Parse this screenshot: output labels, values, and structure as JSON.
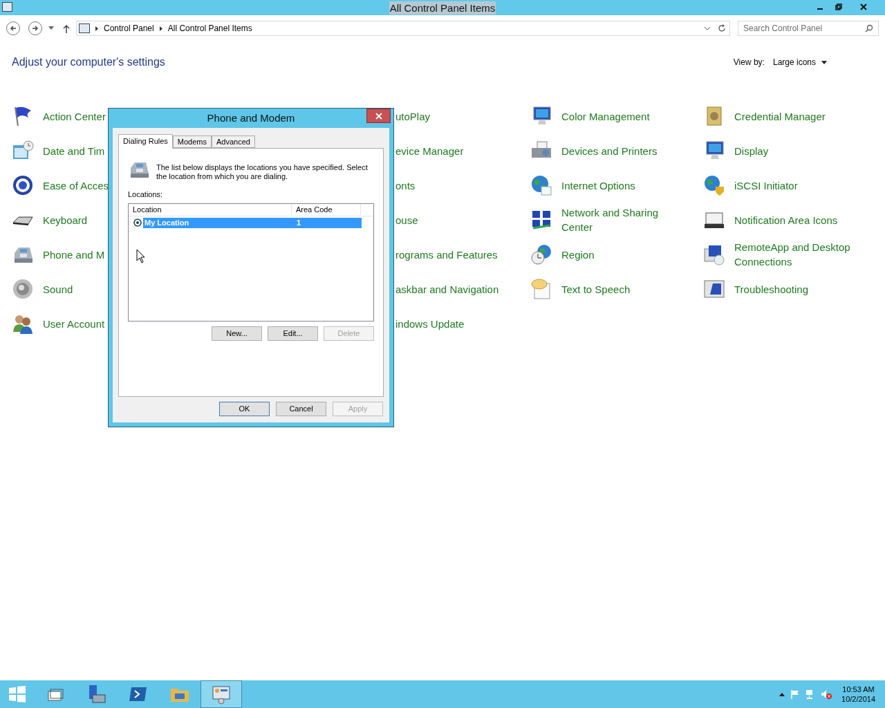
{
  "window": {
    "title": "All Control Panel Items"
  },
  "address_bar": {
    "breadcrumbs": [
      "Control Panel",
      "All Control Panel Items"
    ]
  },
  "search": {
    "placeholder": "Search Control Panel"
  },
  "heading": "Adjust your computer's settings",
  "view_by": {
    "label": "View by:",
    "value": "Large icons"
  },
  "columns": [
    {
      "items": [
        {
          "label": "Action Center"
        },
        {
          "label": "Date and Tim"
        },
        {
          "label": "Ease of Acces"
        },
        {
          "label": "Keyboard"
        },
        {
          "label": "Phone and M"
        },
        {
          "label": "Sound"
        },
        {
          "label": "User Account"
        }
      ]
    },
    {
      "items": [
        {
          "label": "utoPlay"
        },
        {
          "label": "evice Manager"
        },
        {
          "label": "onts"
        },
        {
          "label": "ouse"
        },
        {
          "label": "rograms and Features"
        },
        {
          "label": "askbar and Navigation"
        },
        {
          "label": "indows Update"
        }
      ]
    },
    {
      "items": [
        {
          "label": "Color Management"
        },
        {
          "label": "Devices and Printers"
        },
        {
          "label": "Internet Options"
        },
        {
          "label": "Network and Sharing Center"
        },
        {
          "label": "Region"
        },
        {
          "label": "Text to Speech"
        }
      ]
    },
    {
      "items": [
        {
          "label": "Credential Manager"
        },
        {
          "label": "Display"
        },
        {
          "label": "iSCSI Initiator"
        },
        {
          "label": "Notification Area Icons"
        },
        {
          "label": "RemoteApp and Desktop Connections"
        },
        {
          "label": "Troubleshooting"
        }
      ]
    }
  ],
  "dialog": {
    "title": "Phone and Modem",
    "tabs": [
      {
        "label": "Dialing Rules",
        "selected": true
      },
      {
        "label": "Modems",
        "selected": false
      },
      {
        "label": "Advanced",
        "selected": false
      }
    ],
    "description": "The list below displays the locations you have specified. Select the location from which you are dialing.",
    "locations_label": "Locations:",
    "list": {
      "columns": [
        "Location",
        "Area Code"
      ],
      "rows": [
        {
          "location": "My Location",
          "area_code": "1",
          "selected": true
        }
      ]
    },
    "list_buttons": [
      {
        "label": "New...",
        "disabled": false
      },
      {
        "label": "Edit...",
        "disabled": false
      },
      {
        "label": "Delete",
        "disabled": true
      }
    ],
    "footer_buttons": [
      {
        "label": "OK",
        "disabled": false,
        "default": true
      },
      {
        "label": "Cancel",
        "disabled": false,
        "default": false
      },
      {
        "label": "Apply",
        "disabled": true,
        "default": false
      }
    ]
  },
  "taskbar": {
    "apps": [
      {
        "selected": false
      },
      {
        "selected": false
      },
      {
        "selected": false
      },
      {
        "selected": false
      },
      {
        "selected": true
      }
    ],
    "clock": {
      "time": "10:53 AM",
      "date": "10/2/2014"
    }
  }
}
